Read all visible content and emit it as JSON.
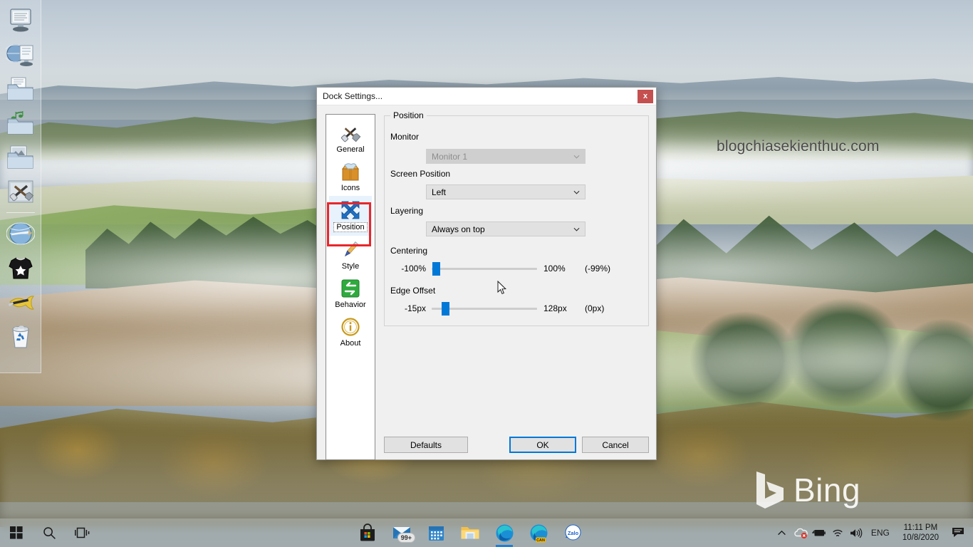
{
  "desktop": {
    "watermark": "blogchiasekienthuc.com",
    "bing_label": "Bing",
    "dock": {
      "items": [
        {
          "name": "monitor-computer",
          "label": "Computer"
        },
        {
          "name": "globe-document",
          "label": "Network"
        },
        {
          "name": "documents-folder",
          "label": "Documents"
        },
        {
          "name": "music-folder",
          "label": "Music"
        },
        {
          "name": "pictures-folder",
          "label": "Pictures"
        },
        {
          "name": "tools",
          "label": "Tools"
        },
        {
          "name": "globe-browser",
          "label": "Internet"
        },
        {
          "name": "tshirt",
          "label": "Shirt"
        },
        {
          "name": "fish-tools",
          "label": "Utilities"
        },
        {
          "name": "recycle-bin",
          "label": "Recycle Bin"
        }
      ]
    }
  },
  "dialog": {
    "title": "Dock Settings...",
    "close_label": "x",
    "sidebar": [
      {
        "label": "General",
        "icon": "hammer-wrench-icon",
        "selected": false
      },
      {
        "label": "Icons",
        "icon": "box-icon",
        "selected": false
      },
      {
        "label": "Position",
        "icon": "move-arrows-icon",
        "selected": true
      },
      {
        "label": "Style",
        "icon": "pen-icon",
        "selected": false
      },
      {
        "label": "Behavior",
        "icon": "swap-arrows-icon",
        "selected": false
      },
      {
        "label": "About",
        "icon": "info-icon",
        "selected": false
      }
    ],
    "group_title": "Position",
    "fields": {
      "monitor_label": "Monitor",
      "monitor_value": "Monitor 1",
      "screen_position_label": "Screen Position",
      "screen_position_value": "Left",
      "layering_label": "Layering",
      "layering_value": "Always on top",
      "centering_label": "Centering",
      "edge_offset_label": "Edge Offset"
    },
    "sliders": {
      "centering": {
        "min_label": "-100%",
        "max_label": "100%",
        "current_label": "(-99%)",
        "percent": 1
      },
      "edge_offset": {
        "min_label": "-15px",
        "max_label": "128px",
        "current_label": "(0px)",
        "percent": 10
      }
    },
    "buttons": {
      "defaults": "Defaults",
      "ok": "OK",
      "cancel": "Cancel"
    },
    "accent_color": "#0078d7",
    "highlight_color": "#e8262a"
  },
  "taskbar": {
    "start_label": "Start",
    "search_label": "Search",
    "taskview_label": "Task View",
    "apps": [
      {
        "name": "microsoft-store",
        "label": "Microsoft Store",
        "badge": "",
        "active": false
      },
      {
        "name": "mail",
        "label": "Mail",
        "badge": "99+",
        "active": false
      },
      {
        "name": "calendar",
        "label": "Calendar",
        "badge": "",
        "active": false
      },
      {
        "name": "file-explorer",
        "label": "File Explorer",
        "badge": "",
        "active": false
      },
      {
        "name": "microsoft-edge",
        "label": "Microsoft Edge",
        "badge": "",
        "active": true
      },
      {
        "name": "edge-canary",
        "label": "Edge Canary",
        "badge": "CAN",
        "active": false
      },
      {
        "name": "zalo",
        "label": "Zalo",
        "badge": "",
        "active": false
      }
    ],
    "tray": {
      "language": "ENG",
      "time": "11:11 PM",
      "date": "10/8/2020"
    }
  }
}
